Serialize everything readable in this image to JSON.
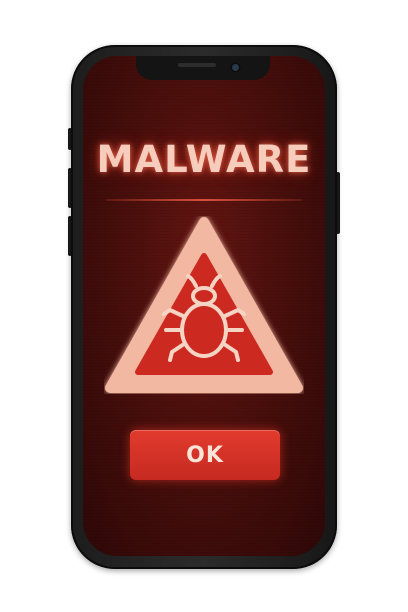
{
  "alert": {
    "title": "MALWARE",
    "icon": "bug-warning-icon",
    "ok_label": "OK"
  },
  "colors": {
    "screen_background": "#4a0f0c",
    "title_glow": "#f6cdbc",
    "triangle_outline": "#f2b8a2",
    "triangle_fill": "#cc2a20",
    "button_fill": "#d63428",
    "button_text": "#fbe3d8"
  }
}
